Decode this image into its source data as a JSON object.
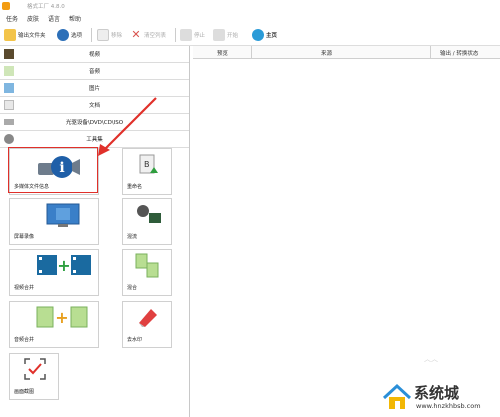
{
  "window": {
    "title": "格式工厂 4.8.0"
  },
  "menu": [
    "任务",
    "皮肤",
    "语言",
    "帮助"
  ],
  "toolbar": {
    "output_folder": "输出文件夹",
    "options": "选项",
    "remove": "移除",
    "clear_list": "清空列表",
    "stop": "停止",
    "start": "开始",
    "home": "主页"
  },
  "categories": {
    "video": "视频",
    "audio": "音频",
    "image": "图片",
    "document": "文档",
    "optical": "光驱设备\\DVD\\CD\\ISO",
    "toolbox": "工具集"
  },
  "tools": {
    "media_info": "多媒体文件信息",
    "rename": "重命名",
    "screen_record": "屏幕录像",
    "mix": "混流",
    "video_join": "视频合并",
    "audio_mix": "混合",
    "audio_join": "音频合并",
    "watermark": "去水印",
    "screenshot": "画面截图"
  },
  "table": {
    "headers": [
      "预览",
      "来源",
      "输出 / 转换状态"
    ]
  },
  "watermark": {
    "cn": "系统城",
    "url": "www.hnzkhbsb.com"
  },
  "colors": {
    "accent_red": "#e0302a",
    "orange": "#f39c12"
  }
}
